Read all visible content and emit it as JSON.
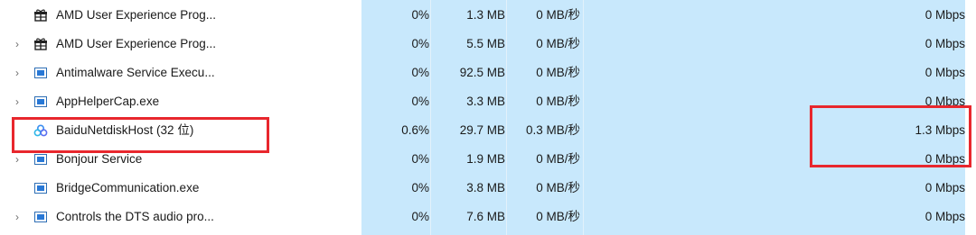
{
  "processes": [
    {
      "name": "AMD User Experience Prog...",
      "icon": "amd-gift-icon",
      "expandable": false,
      "cpu": "0%",
      "memory": "1.3 MB",
      "disk": "0 MB/秒",
      "network": "0 Mbps"
    },
    {
      "name": "AMD User Experience Prog...",
      "icon": "amd-gift-icon",
      "expandable": true,
      "cpu": "0%",
      "memory": "5.5 MB",
      "disk": "0 MB/秒",
      "network": "0 Mbps"
    },
    {
      "name": "Antimalware Service Execu...",
      "icon": "app-window-icon",
      "expandable": true,
      "cpu": "0%",
      "memory": "92.5 MB",
      "disk": "0 MB/秒",
      "network": "0 Mbps"
    },
    {
      "name": "AppHelperCap.exe",
      "icon": "app-window-icon",
      "expandable": true,
      "cpu": "0%",
      "memory": "3.3 MB",
      "disk": "0 MB/秒",
      "network": "0 Mbps"
    },
    {
      "name": "BaiduNetdiskHost (32 位)",
      "icon": "baidu-netdisk-icon",
      "expandable": false,
      "cpu": "0.6%",
      "memory": "29.7 MB",
      "disk": "0.3 MB/秒",
      "network": "1.3 Mbps"
    },
    {
      "name": "Bonjour Service",
      "icon": "app-window-icon",
      "expandable": true,
      "cpu": "0%",
      "memory": "1.9 MB",
      "disk": "0 MB/秒",
      "network": "0 Mbps"
    },
    {
      "name": "BridgeCommunication.exe",
      "icon": "app-window-icon",
      "expandable": false,
      "cpu": "0%",
      "memory": "3.8 MB",
      "disk": "0 MB/秒",
      "network": "0 Mbps"
    },
    {
      "name": "Controls the DTS audio pro...",
      "icon": "app-window-icon",
      "expandable": true,
      "cpu": "0%",
      "memory": "7.6 MB",
      "disk": "0 MB/秒",
      "network": "0 Mbps"
    }
  ],
  "colors": {
    "highlight_column": "#c8e8fc",
    "annotation_box": "#e8272d"
  }
}
